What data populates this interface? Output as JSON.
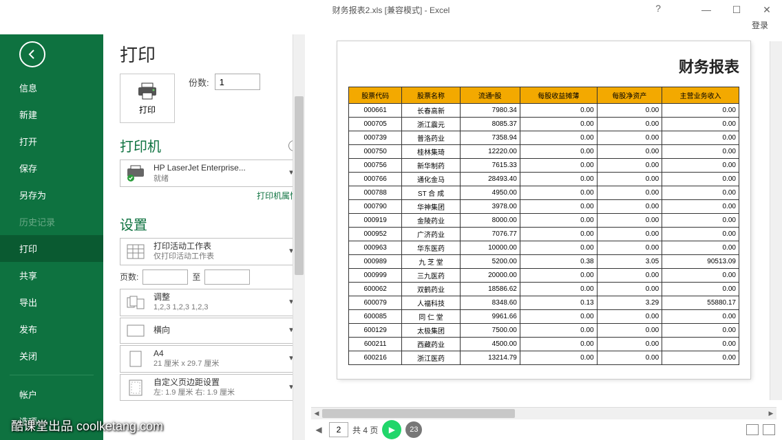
{
  "window": {
    "title": "财务报表2.xls  [兼容模式] - Excel",
    "login": "登录"
  },
  "nav": {
    "items": [
      {
        "k": "info",
        "label": "信息"
      },
      {
        "k": "new",
        "label": "新建"
      },
      {
        "k": "open",
        "label": "打开"
      },
      {
        "k": "save",
        "label": "保存"
      },
      {
        "k": "saveas",
        "label": "另存为"
      },
      {
        "k": "history",
        "label": "历史记录",
        "muted": true
      },
      {
        "k": "print",
        "label": "打印",
        "active": true
      },
      {
        "k": "share",
        "label": "共享"
      },
      {
        "k": "export",
        "label": "导出"
      },
      {
        "k": "publish",
        "label": "发布"
      },
      {
        "k": "close",
        "label": "关闭"
      }
    ],
    "bottom": [
      {
        "k": "account",
        "label": "帐户"
      },
      {
        "k": "options",
        "label": "选项"
      }
    ]
  },
  "print": {
    "heading": "打印",
    "button_label": "打印",
    "copies_label": "份数:",
    "copies_value": "1",
    "printer_heading": "打印机",
    "printer_name": "HP LaserJet Enterprise...",
    "printer_status": "就绪",
    "printer_props_link": "打印机属性",
    "settings_heading": "设置",
    "scope": {
      "title": "打印活动工作表",
      "sub": "仅打印活动工作表"
    },
    "pages_label": "页数:",
    "pages_to": "至",
    "collate": {
      "title": "调整",
      "sub": "1,2,3    1,2,3    1,2,3"
    },
    "orientation": {
      "title": "横向"
    },
    "paper": {
      "title": "A4",
      "sub": "21 厘米 x 29.7 厘米"
    },
    "margins": {
      "title": "自定义页边距设置",
      "sub": "左: 1.9 厘米    右: 1.9 厘米"
    }
  },
  "preview": {
    "sheet_title": "财务报表",
    "headers": [
      "股票代码",
      "股票名称",
      "流通ⁿ股",
      "每股收益摊薄",
      "每股净资产",
      "主营业务收入"
    ],
    "rows": [
      [
        "000661",
        "长春高新",
        "7980.34",
        "0.00",
        "0.00",
        "0.00"
      ],
      [
        "000705",
        "浙江震元",
        "8085.37",
        "0.00",
        "0.00",
        "0.00"
      ],
      [
        "000739",
        "普洛药业",
        "7358.94",
        "0.00",
        "0.00",
        "0.00"
      ],
      [
        "000750",
        "桂林集琦",
        "12220.00",
        "0.00",
        "0.00",
        "0.00"
      ],
      [
        "000756",
        "新华制药",
        "7615.33",
        "0.00",
        "0.00",
        "0.00"
      ],
      [
        "000766",
        "通化金马",
        "28493.40",
        "0.00",
        "0.00",
        "0.00"
      ],
      [
        "000788",
        "ST 合 成",
        "4950.00",
        "0.00",
        "0.00",
        "0.00"
      ],
      [
        "000790",
        "华神集团",
        "3978.00",
        "0.00",
        "0.00",
        "0.00"
      ],
      [
        "000919",
        "金陵药业",
        "8000.00",
        "0.00",
        "0.00",
        "0.00"
      ],
      [
        "000952",
        "广济药业",
        "7076.77",
        "0.00",
        "0.00",
        "0.00"
      ],
      [
        "000963",
        "华东医药",
        "10000.00",
        "0.00",
        "0.00",
        "0.00"
      ],
      [
        "000989",
        "九 芝 堂",
        "5200.00",
        "0.38",
        "3.05",
        "90513.09"
      ],
      [
        "000999",
        "三九医药",
        "20000.00",
        "0.00",
        "0.00",
        "0.00"
      ],
      [
        "600062",
        "双鹤药业",
        "18586.62",
        "0.00",
        "0.00",
        "0.00"
      ],
      [
        "600079",
        "人福科技",
        "8348.60",
        "0.13",
        "3.29",
        "55880.17"
      ],
      [
        "600085",
        "同 仁 堂",
        "9961.66",
        "0.00",
        "0.00",
        "0.00"
      ],
      [
        "600129",
        "太极集团",
        "7500.00",
        "0.00",
        "0.00",
        "0.00"
      ],
      [
        "600211",
        "西藏药业",
        "4500.00",
        "0.00",
        "0.00",
        "0.00"
      ],
      [
        "600216",
        "浙江医药",
        "13214.79",
        "0.00",
        "0.00",
        "0.00"
      ]
    ],
    "current_page": "2",
    "total_label": "共 4 页",
    "badge": "23"
  },
  "watermark": "酷课堂出品 coolketang.com"
}
